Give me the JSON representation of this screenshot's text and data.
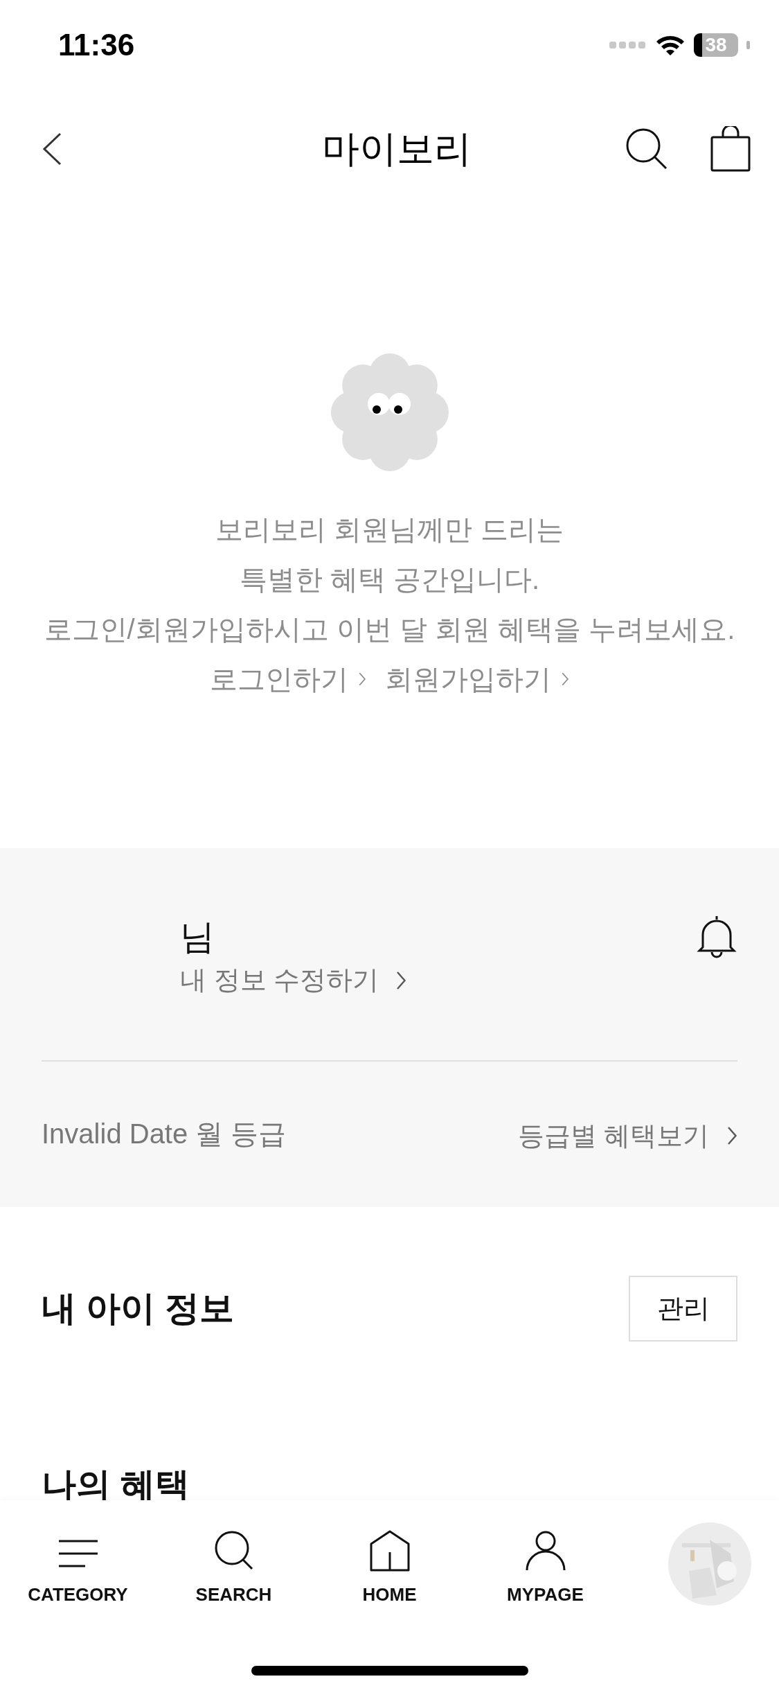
{
  "status_bar": {
    "time": "11:36",
    "battery": "38"
  },
  "header": {
    "title": "마이보리"
  },
  "guest_notice": {
    "lines": [
      "보리보리 회원님께만 드리는",
      "특별한 혜택 공간입니다.",
      "로그인/회원가입하시고 이번 달 회원 혜택을 누려보세요."
    ],
    "links": [
      {
        "label": "로그인하기"
      },
      {
        "label": "회원가입하기"
      }
    ]
  },
  "member": {
    "name": "님",
    "edit_link": "내 정보 수정하기",
    "grade": "Invalid Date 월 등급",
    "benefits_link": "등급별 혜택보기"
  },
  "child_info": {
    "title": "내 아이 정보",
    "button": "관리"
  },
  "benefits": {
    "title": "나의 혜택"
  },
  "tab_bar": {
    "items": [
      {
        "label": "CATEGORY",
        "kind": "category"
      },
      {
        "label": "SEARCH",
        "kind": "search"
      },
      {
        "label": "HOME",
        "kind": "home"
      },
      {
        "label": "MYPAGE",
        "kind": "mypage"
      }
    ]
  }
}
